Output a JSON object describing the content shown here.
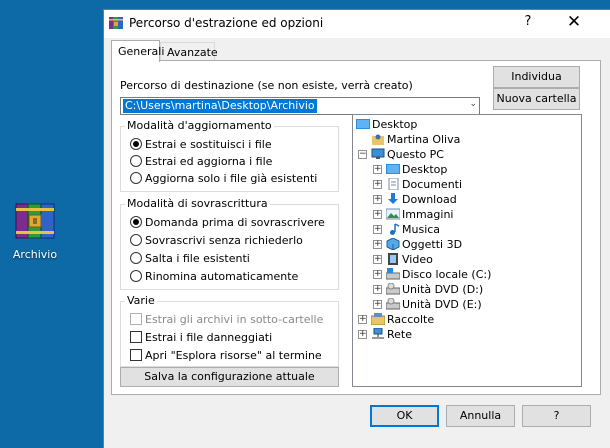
{
  "desktop": {
    "icon_label": "Archivio",
    "background": "#0e6aa6"
  },
  "dialog": {
    "title": "Percorso d'estrazione ed opzioni",
    "help_glyph": "?",
    "close_glyph": "✕",
    "tabs": [
      {
        "label": "Generali",
        "active": true
      },
      {
        "label": "Avanzate",
        "active": false
      }
    ],
    "destination": {
      "label": "Percorso di destinazione (se non esiste, verrà creato)",
      "value": "C:\\Users\\martina\\Desktop\\Archivio",
      "browse_label": "Individua",
      "new_folder_label": "Nuova cartella"
    },
    "update_mode": {
      "title": "Modalità d'aggiornamento",
      "options": [
        {
          "label": "Estrai e sostituisci i file",
          "selected": true
        },
        {
          "label": "Estrai ed aggiorna i file",
          "selected": false
        },
        {
          "label": "Aggiorna solo i file già esistenti",
          "selected": false
        }
      ]
    },
    "overwrite_mode": {
      "title": "Modalità di sovrascrittura",
      "options": [
        {
          "label": "Domanda prima di sovrascrivere",
          "selected": true
        },
        {
          "label": "Sovrascrivi senza richiederlo",
          "selected": false
        },
        {
          "label": "Salta i file esistenti",
          "selected": false
        },
        {
          "label": "Rinomina automaticamente",
          "selected": false
        }
      ]
    },
    "misc": {
      "title": "Varie",
      "options": [
        {
          "label": "Estrai gli archivi in sotto-cartelle",
          "checked": false,
          "disabled": true
        },
        {
          "label": "Estrai i file danneggiati",
          "checked": false,
          "disabled": false
        },
        {
          "label": "Apri \"Esplora risorse\" al termine",
          "checked": false,
          "disabled": false
        }
      ]
    },
    "save_label": "Salva la configurazione attuale",
    "tree": [
      {
        "label": "Desktop",
        "icon": "desktop-folder-icon"
      },
      {
        "label": "Martina Oliva",
        "icon": "user-folder-icon"
      },
      {
        "label": "Questo PC",
        "icon": "computer-icon"
      },
      {
        "label": "Desktop",
        "icon": "desktop-folder-icon"
      },
      {
        "label": "Documenti",
        "icon": "documents-icon"
      },
      {
        "label": "Download",
        "icon": "download-icon"
      },
      {
        "label": "Immagini",
        "icon": "pictures-icon"
      },
      {
        "label": "Musica",
        "icon": "music-icon"
      },
      {
        "label": "Oggetti 3D",
        "icon": "objects-3d-icon"
      },
      {
        "label": "Video",
        "icon": "video-icon"
      },
      {
        "label": "Disco locale (C:)",
        "icon": "local-disk-icon"
      },
      {
        "label": "Unità DVD (D:)",
        "icon": "dvd-drive-icon"
      },
      {
        "label": "Unità DVD (E:)",
        "icon": "dvd-drive-icon"
      },
      {
        "label": "Raccolte",
        "icon": "libraries-icon"
      },
      {
        "label": "Rete",
        "icon": "network-icon"
      }
    ],
    "expand_glyph": "+",
    "collapse_glyph": "−",
    "combo_arrow": "⌄",
    "buttons": {
      "ok": "OK",
      "cancel": "Annulla",
      "help": "?"
    },
    "accent": "#0078d7"
  }
}
